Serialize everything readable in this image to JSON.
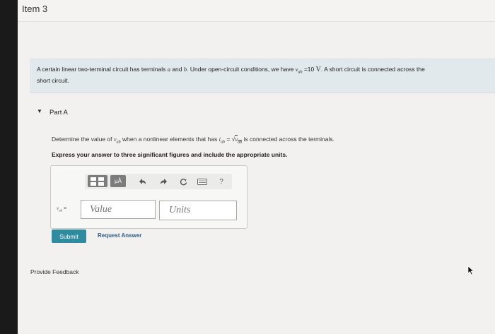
{
  "header": {
    "item_title": "Item 3"
  },
  "problem": {
    "text_before_a": "A certain linear two-terminal circuit has terminals ",
    "var_a": "a",
    "text_and": " and ",
    "var_b": "b",
    "text_conditions": ". Under open-circuit conditions, we have ",
    "var_vab": "v",
    "vab_sub": "ab",
    "value_text": " =10 ",
    "unit_v": "V",
    "text_after": ". A short circuit is connected across the",
    "text_line2": "short circuit."
  },
  "part": {
    "label": "Part A",
    "caret_icon": "caret-down-icon"
  },
  "question": {
    "prompt_prefix": "Determine the value of ",
    "var_v": "v",
    "var_sub": "ab",
    "prompt_middle": " when a nonlinear elements that has ",
    "var_i": "i",
    "i_sub": "ab",
    "equals": " = ",
    "radical_sign": "√",
    "radicand_var": "v",
    "radicand_sub": "ab",
    "prompt_suffix": " is connected across the terminals.",
    "instruction": "Express your answer to three significant figures and include the appropriate units."
  },
  "toolbar": {
    "unit_label": "μÅ",
    "help_label": "?"
  },
  "answer": {
    "var_label": "v",
    "var_sub": "ab",
    "equals": " =",
    "value_placeholder": "Value",
    "units_placeholder": "Units"
  },
  "actions": {
    "submit_label": "Submit",
    "request_answer_label": "Request Answer"
  },
  "footer": {
    "feedback_label": "Provide Feedback"
  },
  "colors": {
    "submit_bg": "#2f8ba0",
    "link": "#2a5f86",
    "problem_bg": "#e1e9ec",
    "page_bg": "#f2f1ef"
  }
}
